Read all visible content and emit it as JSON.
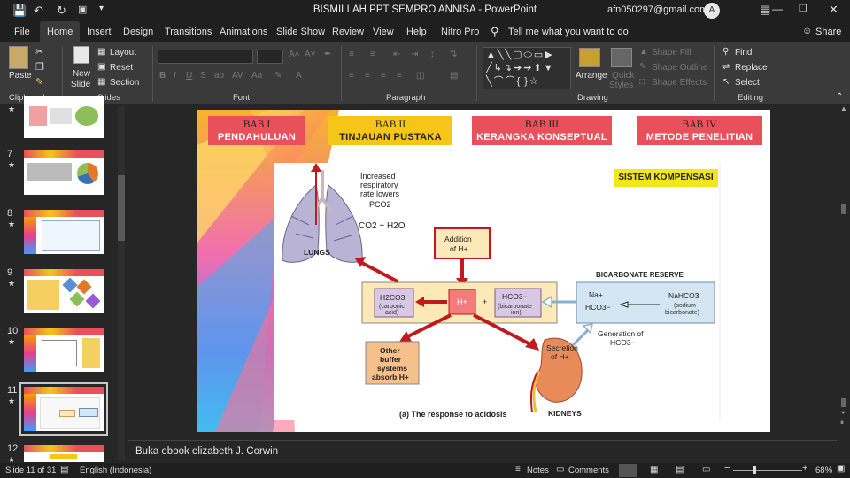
{
  "titlebar": {
    "title": "BISMILLAH PPT SEMPRO ANNISA  -  PowerPoint",
    "user_email": "afn050297@gmail.com",
    "avatar_initial": "A"
  },
  "tabs": [
    "File",
    "Home",
    "Insert",
    "Design",
    "Transitions",
    "Animations",
    "Slide Show",
    "Review",
    "View",
    "Help",
    "Nitro Pro"
  ],
  "active_tab": "Home",
  "tell_me": "Tell me what you want to do",
  "share": "Share",
  "ribbon": {
    "clipboard": {
      "label": "Clipboard",
      "paste": "Paste"
    },
    "slides": {
      "label": "Slides",
      "new_slide_1": "New",
      "new_slide_2": "Slide",
      "layout": "Layout",
      "reset": "Reset",
      "section": "Section"
    },
    "font": {
      "label": "Font"
    },
    "paragraph": {
      "label": "Paragraph"
    },
    "drawing": {
      "label": "Drawing",
      "arrange": "Arrange",
      "quick_styles_1": "Quick",
      "quick_styles_2": "Styles",
      "shape_fill": "Shape Fill",
      "shape_outline": "Shape Outline",
      "shape_effects": "Shape Effects"
    },
    "editing": {
      "label": "Editing",
      "find": "Find",
      "replace": "Replace",
      "select": "Select"
    }
  },
  "thumbnails": [
    {
      "num": "",
      "star": "★"
    },
    {
      "num": "7",
      "star": "★"
    },
    {
      "num": "8",
      "star": "★"
    },
    {
      "num": "9",
      "star": "★"
    },
    {
      "num": "10",
      "star": "★"
    },
    {
      "num": "11",
      "star": "★"
    },
    {
      "num": "12",
      "star": "★"
    }
  ],
  "slide": {
    "bab": [
      {
        "l1": "BAB I",
        "l2": "PENDAHULUAN",
        "bg": "#e8505b",
        "fg": "#ffffff"
      },
      {
        "l1": "BAB II",
        "l2": "TINJAUAN PUSTAKA",
        "bg": "#f5c518",
        "fg": "#222222"
      },
      {
        "l1": "BAB III",
        "l2": "KERANGKA KONSEPTUAL",
        "bg": "#e8505b",
        "fg": "#ffffff"
      },
      {
        "l1": "BAB IV",
        "l2": "METODE PENELITIAN",
        "bg": "#e8505b",
        "fg": "#ffffff"
      }
    ],
    "label_sistem": "SISTEM KOMPENSASI",
    "diagram": {
      "resp_1": "Increased",
      "resp_2": "respiratory",
      "resp_3": "rate lowers",
      "resp_4": "PCO2",
      "co2": "CO2 + H2O",
      "lungs": "LUNGS",
      "addition_1": "Addition",
      "addition_2": "of H+",
      "bicarb_reserve": "BICARBONATE RESERVE",
      "h2co3": "H2CO3",
      "h2co3_sub": "(carbonic",
      "h2co3_sub2": "acid)",
      "hplus": "H+",
      "plus": "+",
      "hco3": "HCO3−",
      "hco3_sub": "(bicarbonate",
      "hco3_sub2": "ion)",
      "na": "Na+",
      "hco3b": "HCO3−",
      "nahco3": "NaHCO3",
      "nahco3_sub": "(sodium",
      "nahco3_sub2": "bicarbonate)",
      "generation_1": "Generation of",
      "generation_2": "HCO3−",
      "other_1": "Other",
      "other_2": "buffer",
      "other_3": "systems",
      "other_4": "absorb H+",
      "secretion_1": "Secretion",
      "secretion_2": "of H+",
      "kidneys": "KIDNEYS",
      "caption": "(a) The response to acidosis"
    }
  },
  "notes_text": "Buka ebook elizabeth J. Corwin",
  "status": {
    "slide_info": "Slide 11 of 31",
    "language": "English (Indonesia)",
    "notes": "Notes",
    "comments": "Comments",
    "zoom": "68%"
  }
}
